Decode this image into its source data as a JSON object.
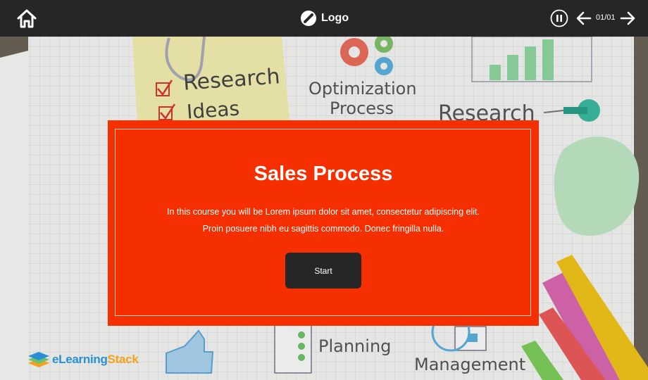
{
  "topbar": {
    "logo_text": "Logo",
    "page_counter": "01/01",
    "icons": {
      "home": "home-icon",
      "logo": "logo-mark-icon",
      "pause": "pause-icon",
      "prev": "arrow-left-icon",
      "next": "arrow-right-icon"
    }
  },
  "background": {
    "labels": {
      "research": "Research",
      "ideas": "Ideas",
      "optimization_line1": "Optimization",
      "optimization_line2": "Process",
      "research_partial": "Research",
      "planning": "Planning",
      "management": "Management"
    }
  },
  "card": {
    "title": "Sales Process",
    "description_line1": "In this course you will be Lorem ipsum dolor sit amet, consectetur adipiscing elit.",
    "description_line2": "Proin posuere nibh eu sagittis commodo. Donec fringilla nulla.",
    "start_label": "Start",
    "colors": {
      "background": "#f52f00",
      "button": "#262626"
    }
  },
  "brand": {
    "part1": "eLearning",
    "part2": "Stack",
    "colors": {
      "e": "#2a8fd6",
      "stack": "#f4a21c"
    }
  }
}
